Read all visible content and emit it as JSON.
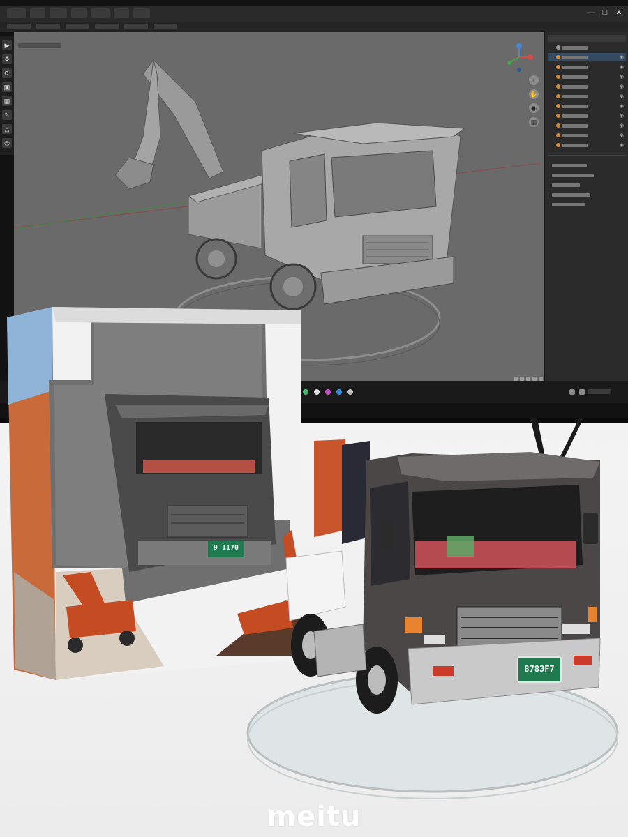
{
  "brand": {
    "watermark": "meitu"
  },
  "toy_truck": {
    "plate_text": "8783F7"
  },
  "boxed_truck": {
    "plate_text": "9 1170"
  },
  "icons": {
    "minimize": "minimize-icon",
    "restore": "restore-icon",
    "close": "close-icon"
  },
  "colors": {
    "plate_green": "#1f7a50",
    "box_accent_orange": "#c44b22",
    "viewport_gray": "#6a6a6a"
  }
}
